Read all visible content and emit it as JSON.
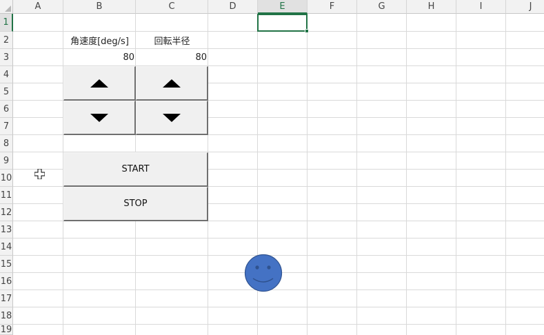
{
  "sheet": {
    "columns": [
      "A",
      "B",
      "C",
      "D",
      "E",
      "F",
      "G",
      "H",
      "I",
      "J"
    ],
    "rows": [
      "1",
      "2",
      "3",
      "4",
      "5",
      "6",
      "7",
      "8",
      "9",
      "10",
      "11",
      "12",
      "13",
      "14",
      "15",
      "16",
      "17",
      "18",
      "19"
    ],
    "selected_column": "E",
    "selected_row": "1",
    "cells": {
      "B2": "角速度[deg/s]",
      "C2": "回転半径",
      "B3": "80",
      "C3": "80"
    }
  },
  "controls": {
    "angular_up_icon": "up-triangle",
    "angular_down_icon": "down-triangle",
    "radius_up_icon": "up-triangle",
    "radius_down_icon": "down-triangle",
    "start_label": "START",
    "stop_label": "STOP"
  },
  "shapes": {
    "smiley_color": "#4472c4",
    "smiley_icon": "smiley-face"
  },
  "colors": {
    "accent": "#217346",
    "header_bg": "#f2f2f2",
    "gridline": "#d9d9d9"
  }
}
